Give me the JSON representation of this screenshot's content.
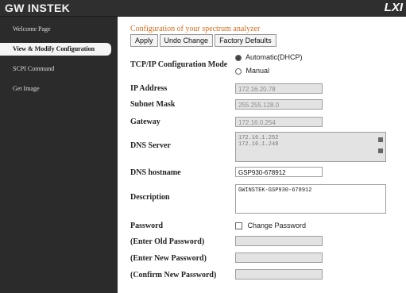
{
  "header": {
    "logo": "GW INSTEK",
    "right_logo": "LXI"
  },
  "sidebar": {
    "items": [
      {
        "label": "Welcome Page",
        "active": false
      },
      {
        "label": "View & Modify Configuration",
        "active": true
      },
      {
        "label": "SCPI Command",
        "active": false
      },
      {
        "label": "Get Image",
        "active": false
      }
    ]
  },
  "main": {
    "title": "Configuration of your spectrum analyzer",
    "buttons": {
      "apply": "Apply",
      "undo": "Undo Change",
      "factory": "Factory Defaults"
    },
    "tcpip": {
      "label": "TCP/IP Configuration Mode",
      "auto": "Automatic(DHCP)",
      "manual": "Manual"
    },
    "fields": {
      "ip_address": {
        "label": "IP Address",
        "value": "172.16.20.78"
      },
      "subnet_mask": {
        "label": "Subnet Mask",
        "value": "255.255.128.0"
      },
      "gateway": {
        "label": "Gateway",
        "value": "172.16.0.254"
      },
      "dns_server": {
        "label": "DNS Server",
        "line1": "172.16.1.252",
        "line2": "172.16.1.248"
      },
      "dns_hostname": {
        "label": "DNS hostname",
        "value": "GSP930-678912"
      },
      "description": {
        "label": "Description",
        "value": "GWINSTEK-GSP930-678912"
      },
      "password": {
        "label": "Password",
        "checkbox": "Change Password"
      },
      "old_password": {
        "label": "(Enter Old Password)",
        "value": ""
      },
      "new_password": {
        "label": "(Enter New Password)",
        "value": ""
      },
      "confirm_password": {
        "label": "(Confirm New Password)",
        "value": ""
      }
    }
  }
}
